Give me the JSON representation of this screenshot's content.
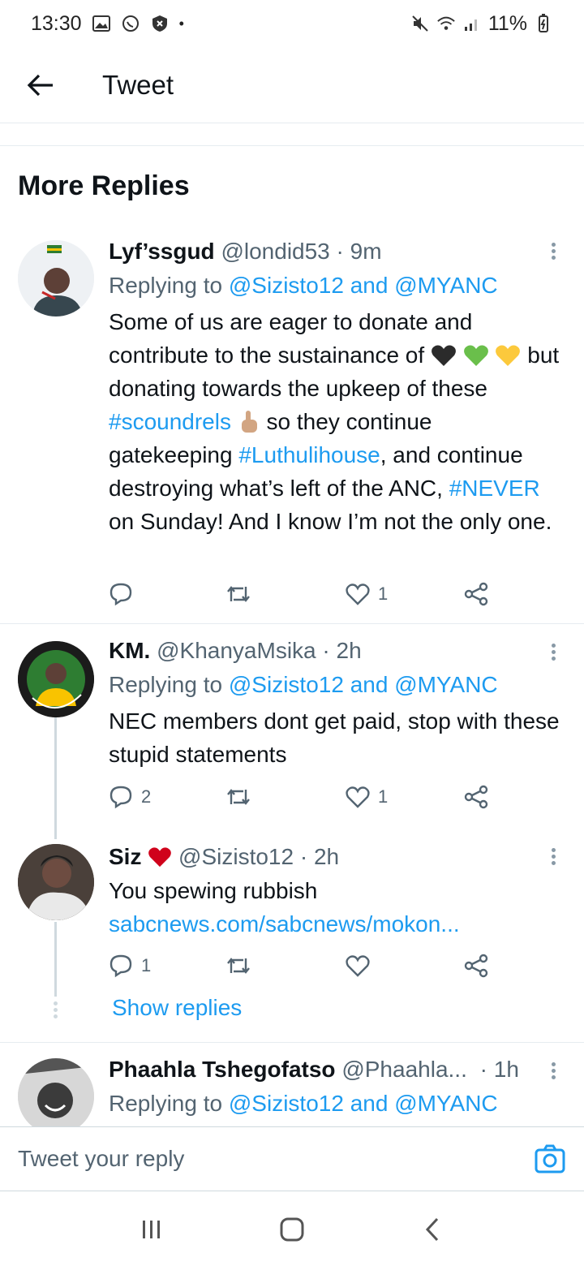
{
  "status": {
    "time": "13:30",
    "battery": "11%"
  },
  "header": {
    "title": "Tweet"
  },
  "section_title": "More Replies",
  "tweets": [
    {
      "name": "Lyf’ssgud",
      "handle": "@londid53",
      "time": "· 9m",
      "replying_prefix": "Replying to ",
      "replying_to": "@Sizisto12 and @MYANC",
      "text_parts": [
        "Some of us are eager to donate and contribute to the sustainance of ",
        "but donating towards the upkeep of these ",
        "#scoundrels",
        " so they continue gatekeeping ",
        "#Luthulihouse",
        ", and continue destroying what’s left of the ANC, ",
        "#NEVER",
        " on Sunday! And  I know I’m not the only one."
      ],
      "replies": "",
      "likes": "1"
    },
    {
      "name": "KM.",
      "handle": "@KhanyaMsika",
      "time": "· 2h",
      "replying_prefix": "Replying to ",
      "replying_to": "@Sizisto12 and @MYANC",
      "text": "NEC members dont get paid, stop with these stupid statements",
      "replies": "2",
      "likes": "1"
    },
    {
      "name": "Siz",
      "handle": "@Sizisto12",
      "time": "· 2h",
      "text": "You spewing rubbish",
      "link": "sabcnews.com/sabcnews/mokon...",
      "replies": "1",
      "likes": ""
    },
    {
      "name": "Phaahla Tshegofatso",
      "handle": "@Phaahla...",
      "time": "· 1h",
      "replying_prefix": "Replying to ",
      "replying_to": "@Sizisto12 and @MYANC"
    }
  ],
  "show_replies": "Show replies",
  "reply_placeholder": "Tweet your reply",
  "colors": {
    "accent": "#1d9bf0",
    "text": "#0f1419",
    "muted": "#536471"
  },
  "icons": [
    "back-arrow-icon",
    "reply-icon",
    "retweet-icon",
    "like-icon",
    "share-icon",
    "more-icon",
    "camera-icon",
    "recents-icon",
    "home-icon",
    "back-nav-icon"
  ]
}
